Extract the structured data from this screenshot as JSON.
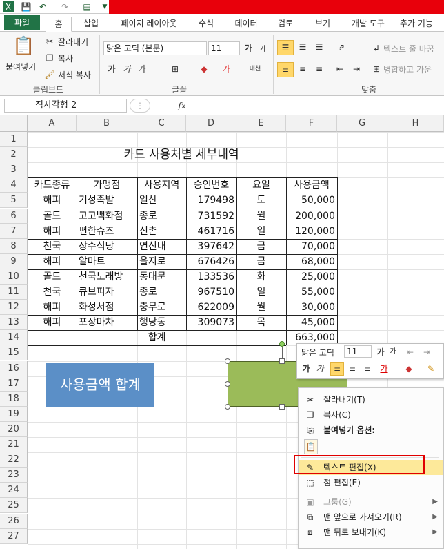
{
  "ribbon_tabs": [
    "파일",
    "홈",
    "삽입",
    "페이지 레이아웃",
    "수식",
    "데이터",
    "검토",
    "보기",
    "개발 도구",
    "추가 기능"
  ],
  "clipboard": {
    "paste": "붙여넣기",
    "cut": "잘라내기",
    "copy": "복사",
    "format_painter": "서식 복사",
    "group": "클립보드"
  },
  "font": {
    "name": "맑은 고딕 (본문)",
    "size": "11",
    "bold": "가",
    "italic": "가",
    "underline": "가",
    "group": "글꼴",
    "ruby": "내천"
  },
  "alignment": {
    "wrap_text": "텍스트 줄 바꿈",
    "merge": "병합하고 가운",
    "group": "맞춤"
  },
  "formula_bar": {
    "name_box": "직사각형 2",
    "fx": "fx",
    "value": ""
  },
  "columns": [
    "A",
    "B",
    "C",
    "D",
    "E",
    "F",
    "G",
    "H"
  ],
  "rows": [
    "1",
    "2",
    "3",
    "4",
    "5",
    "6",
    "7",
    "8",
    "9",
    "10",
    "11",
    "12",
    "13",
    "14",
    "15",
    "16",
    "17",
    "18",
    "19",
    "20",
    "21",
    "22",
    "23",
    "24",
    "25",
    "26",
    "27"
  ],
  "sheet": {
    "title": "카드 사용처별 세부내역",
    "headers": [
      "카드종류",
      "가맹점",
      "사용지역",
      "승인번호",
      "요일",
      "사용금액"
    ],
    "rows": [
      [
        "해피",
        "기성족발",
        "일산",
        "179498",
        "토",
        "50,000"
      ],
      [
        "골드",
        "고고백화점",
        "종로",
        "731592",
        "월",
        "200,000"
      ],
      [
        "해피",
        "편한슈즈",
        "신촌",
        "461716",
        "일",
        "120,000"
      ],
      [
        "천국",
        "장수식당",
        "연신내",
        "397642",
        "금",
        "70,000"
      ],
      [
        "해피",
        "알마트",
        "을지로",
        "676426",
        "금",
        "68,000"
      ],
      [
        "골드",
        "천국노래방",
        "동대문",
        "133536",
        "화",
        "25,000"
      ],
      [
        "천국",
        "큐브피자",
        "종로",
        "967510",
        "일",
        "55,000"
      ],
      [
        "해피",
        "화성서점",
        "충무로",
        "622009",
        "월",
        "30,000"
      ],
      [
        "해피",
        "포장마차",
        "행당동",
        "309073",
        "목",
        "45,000"
      ]
    ],
    "total_label": "합계",
    "total_value": "663,000"
  },
  "shape_text": "사용금액 합계",
  "mini_toolbar": {
    "font": "맑은 고딕",
    "size": "11"
  },
  "context_menu": [
    {
      "label": "잘라내기(T)",
      "icon": "scissors-icon",
      "disabled": false,
      "bold": false,
      "arrow": false
    },
    {
      "label": "복사(C)",
      "icon": "copy-icon",
      "disabled": false,
      "bold": false,
      "arrow": false
    },
    {
      "label": "붙여넣기 옵션:",
      "icon": "paste-icon",
      "disabled": false,
      "bold": true,
      "arrow": false
    },
    {
      "label": "텍스트 편집(X)",
      "icon": "edit-text-icon",
      "disabled": false,
      "bold": false,
      "arrow": false
    },
    {
      "label": "점 편집(E)",
      "icon": "edit-points-icon",
      "disabled": false,
      "bold": false,
      "arrow": false
    },
    {
      "label": "그룹(G)",
      "icon": "group-icon",
      "disabled": true,
      "bold": false,
      "arrow": true
    },
    {
      "label": "맨 앞으로 가져오기(R)",
      "icon": "bring-front-icon",
      "disabled": false,
      "bold": false,
      "arrow": true
    },
    {
      "label": "맨 뒤로 보내기(K)",
      "icon": "send-back-icon",
      "disabled": false,
      "bold": false,
      "arrow": true
    }
  ],
  "colors": {
    "excel_green": "#217346",
    "shape_blue": "#5b8fc7",
    "shape_green": "#9bbb59",
    "highlight_red": "#e00000"
  }
}
